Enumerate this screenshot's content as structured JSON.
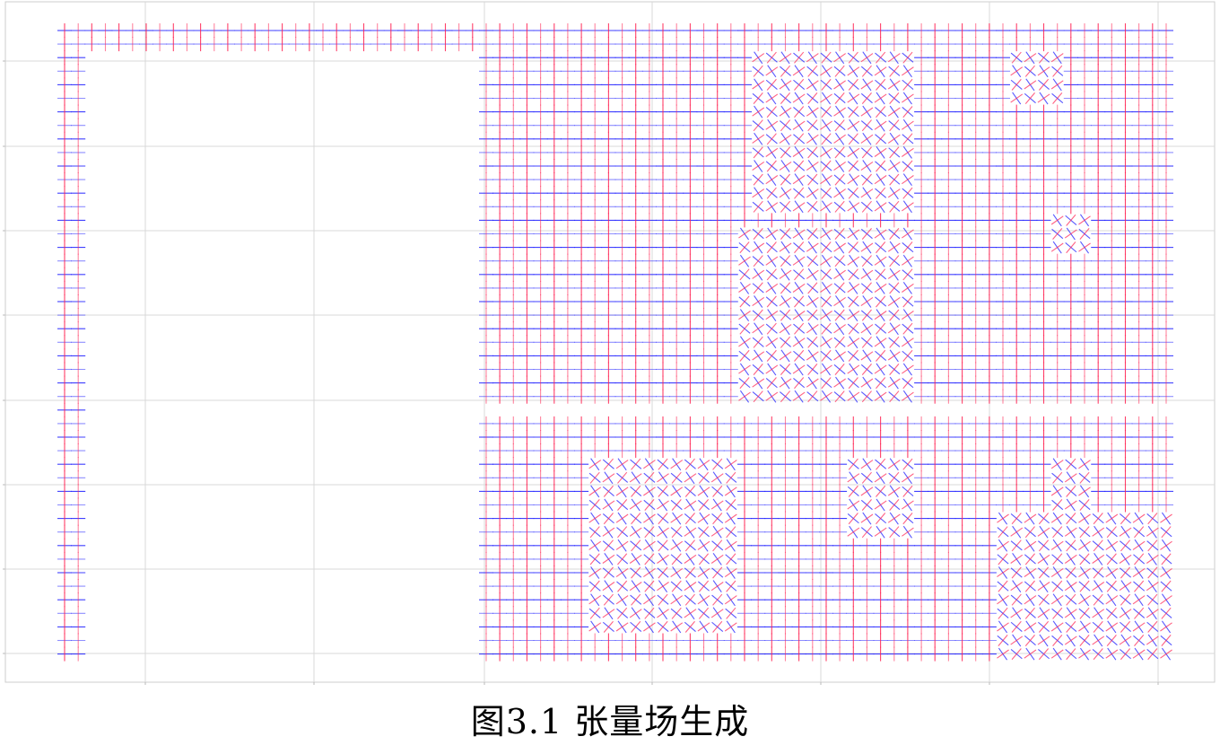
{
  "figure": {
    "caption": "图3.1 张量场生成"
  },
  "colors": {
    "major": "#2020ff",
    "minor": "#ff2050",
    "grid": "#d9d9d9",
    "frame": "#cccccc"
  },
  "chart_data": {
    "type": "scatter",
    "title": "",
    "xlabel": "",
    "ylabel": "",
    "glyph": "tensor-cross",
    "grid": true,
    "legend": "none",
    "xlim": [
      0,
      1360
    ],
    "ylim": [
      0,
      760
    ],
    "y_inverted": true,
    "lattice": {
      "x_start": 72,
      "x_step": 15.16,
      "columns": 82,
      "y_start": 34,
      "y_step": 15.1,
      "rows": 47
    },
    "regions": [
      {
        "name": "",
        "col_range": [
          0,
          81
        ],
        "row_range": [
          0,
          1
        ]
      },
      {
        "name": "",
        "col_range": [
          0,
          1
        ],
        "row_range": [
          0,
          46
        ]
      },
      {
        "name": "",
        "col_range": [
          31,
          81
        ],
        "row_range": [
          0,
          27
        ]
      },
      {
        "name": "",
        "col_range": [
          31,
          81
        ],
        "row_range": [
          29,
          46
        ]
      }
    ],
    "rotated_patches": [
      {
        "col_range": [
          51,
          62
        ],
        "row_range": [
          2,
          13
        ]
      },
      {
        "col_range": [
          50,
          62
        ],
        "row_range": [
          15,
          27
        ]
      },
      {
        "col_range": [
          39,
          49
        ],
        "row_range": [
          32,
          44
        ]
      },
      {
        "col_range": [
          58,
          62
        ],
        "row_range": [
          32,
          37
        ]
      },
      {
        "col_range": [
          69,
          81
        ],
        "row_range": [
          36,
          46
        ]
      },
      {
        "col_range": [
          70,
          73
        ],
        "row_range": [
          2,
          5
        ]
      },
      {
        "col_range": [
          73,
          75
        ],
        "row_range": [
          14,
          16
        ]
      },
      {
        "col_range": [
          73,
          75
        ],
        "row_range": [
          32,
          35
        ]
      }
    ]
  }
}
